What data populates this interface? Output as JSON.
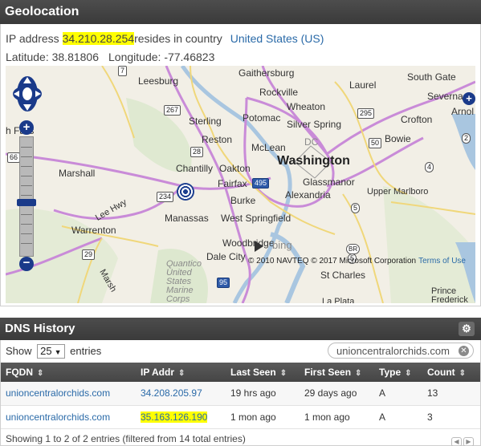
{
  "geolocation": {
    "title": "Geolocation",
    "ip_prefix": "IP address",
    "ip": "34.210.28.254",
    "ip_suffix": "resides in country",
    "country": "United States (US)",
    "latitude_label": "Latitude:",
    "latitude": "38.81806",
    "longitude_label": "Longitude:",
    "longitude": "-77.46823"
  },
  "map": {
    "places": {
      "leesburg": "Leesburg",
      "gaithersburg": "Gaithersburg",
      "rockville": "Rockville",
      "laurel": "Laurel",
      "south_gate": "South Gate",
      "severna": "Severna",
      "arnol": "Arnol",
      "wheaton": "Wheaton",
      "potomac": "Potomac",
      "silver_spring": "Silver Spring",
      "crofton": "Crofton",
      "sterling": "Sterling",
      "reston": "Reston",
      "mclean": "McLean",
      "dc": "DC",
      "bowie": "Bowie",
      "falls": "h Falls",
      "chantilly": "Chantilly",
      "oakton": "Oakton",
      "washington": "Washington",
      "marshall": "Marshall",
      "fairfax": "Fairfax",
      "glassmanor": "Glassmanor",
      "upper_marlboro": "Upper Marlboro",
      "burke": "Burke",
      "alexandria": "Alexandria",
      "lee_hwy": "Lee Hwy",
      "manassas": "Manassas",
      "west_springfield": "West Springfield",
      "warrenton": "Warrenton",
      "woodbridge": "Woodbridge",
      "dale_city": "Dale City",
      "quantico": "Quantico United States Marine Corps",
      "st_charles": "St Charles",
      "marsh": "Marsh",
      "la_plata": "La Plata",
      "prince_frederick": "Prince Frederick",
      "bing": "bing"
    },
    "shields": {
      "r7": "7",
      "r267": "267",
      "r295": "295",
      "r50": "50",
      "r66": "66",
      "r28": "28",
      "r495": "495",
      "r234": "234",
      "r29": "29",
      "r95": "95",
      "r5": "5",
      "r4": "4",
      "r2": "2",
      "r301": "301",
      "rBR": "BR",
      "r5b": "5"
    },
    "copyright": "© 2010 NAVTEQ © 2017 Microsoft Corporation",
    "terms": "Terms of Use",
    "colors": {
      "land": "#f2efe6",
      "water": "#a9c6e0",
      "highway": "#c98bd8",
      "road": "#f0d77a",
      "park": "#d6e6c5"
    }
  },
  "dns": {
    "title": "DNS History",
    "show_label": "Show",
    "page_size": "25",
    "entries_label": "entries",
    "search_value": "unioncentralorchids.com",
    "columns": [
      "FQDN",
      "IP Addr",
      "Last Seen",
      "First Seen",
      "Type",
      "Count"
    ],
    "rows": [
      {
        "fqdn": "unioncentralorchids.com",
        "ip": "34.208.205.97",
        "last_seen": "19 hrs ago",
        "first_seen": "29 days ago",
        "type": "A",
        "count": "13"
      },
      {
        "fqdn": "unioncentralorchids.com",
        "ip": "35.163.126.190",
        "last_seen": "1 mon ago",
        "first_seen": "1 mon ago",
        "type": "A",
        "count": "3"
      }
    ],
    "info": "Showing 1 to 2 of 2 entries (filtered from 14 total entries)"
  }
}
